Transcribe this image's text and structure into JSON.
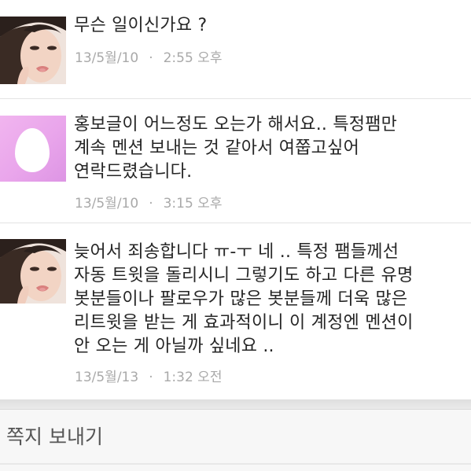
{
  "messages": [
    {
      "avatar": "profile-photo",
      "lines": [
        "무슨 일이신가요 ?"
      ],
      "date": "13/5월/10",
      "separator": "·",
      "time": "2:55 오후"
    },
    {
      "avatar": "default-egg",
      "lines": [
        "홍보글이 어느정도 오는가 해서요.. 특정팸만",
        "계속 멘션 보내는 것 같아서 여쭙고싶어",
        "연락드렸습니다."
      ],
      "date": "13/5월/10",
      "separator": "·",
      "time": "3:15 오후"
    },
    {
      "avatar": "profile-photo",
      "lines": [
        "늦어서 죄송합니다 ㅠ-ㅜ 네 .. 특정 팸들께선",
        "자동 트윗을 돌리시니 그렇기도 하고 다른 유명",
        "봇분들이나 팔로우가 많은 봇분들께 더욱 많은",
        "리트윗을 받는 게 효과적이니 이 계정엔 멘션이",
        "안 오는 게 아닐까 싶네요 .."
      ],
      "date": "13/5월/13",
      "separator": "·",
      "time": "1:32 오전"
    }
  ],
  "composer": {
    "placeholder": "쪽지 보내기"
  },
  "colors": {
    "text": "#262626",
    "meta": "#a9a9a9",
    "egg_background": "#e9a5eb",
    "divider": "#e3e3e3"
  }
}
